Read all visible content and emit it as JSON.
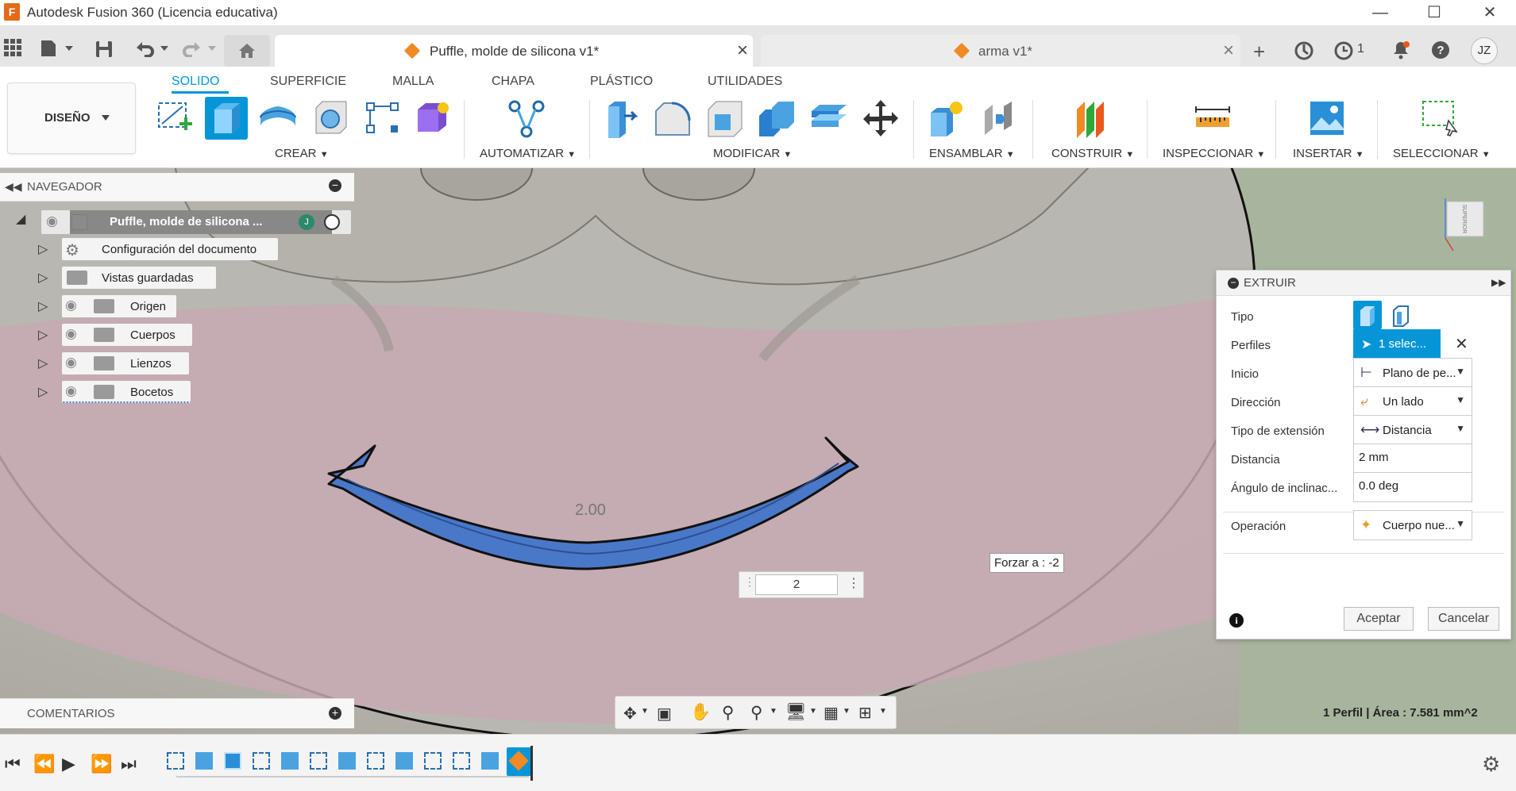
{
  "window": {
    "title": "Autodesk Fusion 360 (Licencia educativa)",
    "app_logo": "F",
    "controls": [
      "minimize-icon",
      "maximize-icon",
      "close-icon"
    ]
  },
  "tabs": [
    {
      "title": "Puffle, molde de silicona v1*",
      "active": true
    },
    {
      "title": "arma v1*",
      "active": false
    }
  ],
  "header_right": {
    "jobs_count": "1",
    "user_initials": "JZ"
  },
  "ribbon": {
    "workspace": "DISEÑO",
    "tabs": [
      "SOLIDO",
      "SUPERFICIE",
      "MALLA",
      "CHAPA",
      "PLÁSTICO",
      "UTILIDADES"
    ],
    "groups": [
      "CREAR",
      "AUTOMATIZAR",
      "MODIFICAR",
      "ENSAMBLAR",
      "CONSTRUIR",
      "INSPECCIONAR",
      "INSERTAR",
      "SELECCIONAR"
    ]
  },
  "navigator": {
    "title": "NAVEGADOR",
    "root": "Puffle, molde de silicona ...",
    "items": [
      {
        "label": "Configuración del documento",
        "icon": "gear-icon"
      },
      {
        "label": "Vistas guardadas",
        "icon": "folder-icon"
      },
      {
        "label": "Origen",
        "icon": "folder-icon"
      },
      {
        "label": "Cuerpos",
        "icon": "folder-icon"
      },
      {
        "label": "Lienzos",
        "icon": "folder-icon"
      },
      {
        "label": "Bocetos",
        "icon": "folder-icon"
      }
    ]
  },
  "viewport": {
    "dimension_label": "2.00",
    "value_input": "2",
    "force_tooltip": "Forzar a : -2",
    "status": "1 Perfil | Área : 7.581 mm^2",
    "viewcube_label": "SUPERIOR"
  },
  "extrude": {
    "title": "EXTRUIR",
    "rows": {
      "tipo": "Tipo",
      "perfiles": "Perfiles",
      "perfiles_value": "1 selec...",
      "inicio": "Inicio",
      "inicio_value": "Plano de pe...",
      "direccion": "Dirección",
      "direccion_value": "Un lado",
      "tipo_extension": "Tipo de extensión",
      "tipo_extension_value": "Distancia",
      "distancia": "Distancia",
      "distancia_value": "2 mm",
      "angulo": "Ángulo de inclinac...",
      "angulo_value": "0.0 deg",
      "operacion": "Operación",
      "operacion_value": "Cuerpo nue..."
    },
    "ok_label": "Aceptar",
    "cancel_label": "Cancelar"
  },
  "comments": {
    "title": "COMENTARIOS"
  },
  "colors": {
    "accent": "#0696d7",
    "profile_blue": "#4a78c8",
    "viewport_bg": "#b9b6ae",
    "pink_region": "#c9a9b4"
  }
}
